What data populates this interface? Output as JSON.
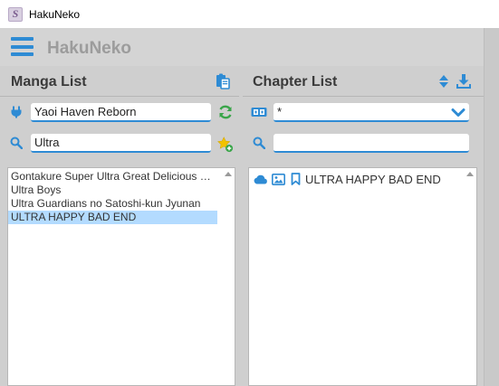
{
  "window": {
    "title": "HakuNeko"
  },
  "appbar": {
    "app_name": "HakuNeko"
  },
  "manga_panel": {
    "title": "Manga List",
    "connector": {
      "value": "Yaoi Haven Reborn"
    },
    "search": {
      "value": "Ultra"
    },
    "items": [
      {
        "label": "Gontakure Super Ultra Great Delicious Wonderful Bento"
      },
      {
        "label": "Ultra Boys"
      },
      {
        "label": "Ultra Guardians no Satoshi-kun Jyunan"
      },
      {
        "label": "ULTRA HAPPY BAD END"
      }
    ],
    "selected_index": 3
  },
  "chapter_panel": {
    "title": "Chapter List",
    "language_filter": {
      "value": "*"
    },
    "search": {
      "value": ""
    },
    "items": [
      {
        "label": "ULTRA HAPPY BAD END"
      }
    ]
  },
  "colors": {
    "accent": "#2e8bd4",
    "refresh_green": "#3aa54a",
    "favorite_yellow": "#f2c200",
    "selection": "#b3dbff"
  }
}
